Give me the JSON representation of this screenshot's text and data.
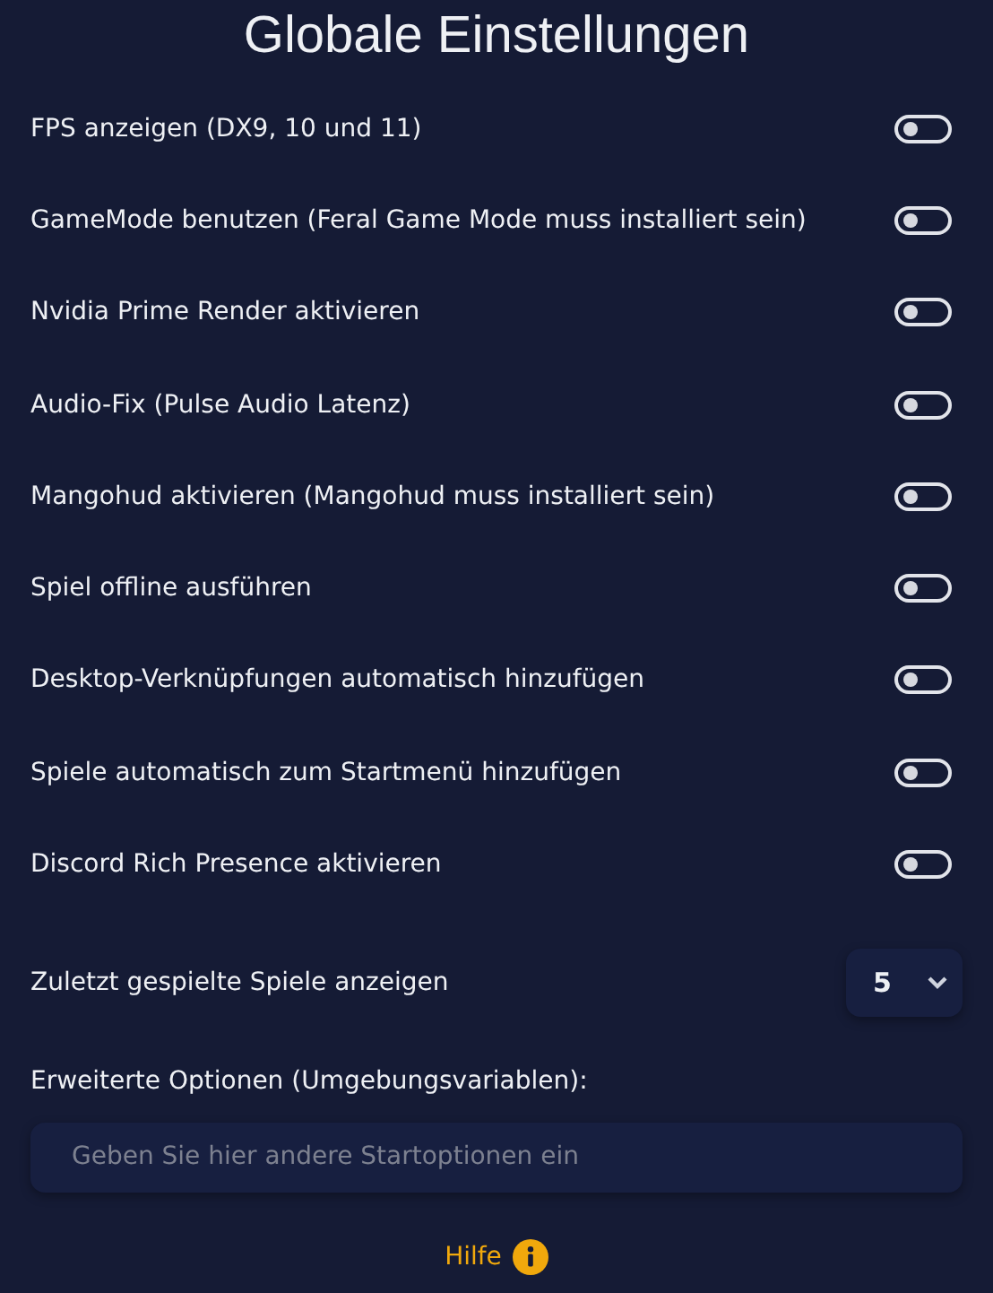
{
  "title": "Globale Einstellungen",
  "settings": [
    {
      "label": "FPS anzeigen (DX9, 10 und 11)",
      "on": false
    },
    {
      "label": "GameMode benutzen (Feral Game Mode muss installiert sein)",
      "on": false
    },
    {
      "label": "Nvidia Prime Render aktivieren",
      "on": false
    },
    {
      "label": "Audio-Fix (Pulse Audio Latenz)",
      "on": false
    },
    {
      "label": "Mangohud aktivieren (Mangohud muss installiert sein)",
      "on": false
    },
    {
      "label": "Spiel offline ausführen",
      "on": false
    },
    {
      "label": "Desktop-Verknüpfungen automatisch hinzufügen",
      "on": false
    },
    {
      "label": "Spiele automatisch zum Startmenü hinzufügen",
      "on": false
    },
    {
      "label": "Discord Rich Presence aktivieren",
      "on": false
    }
  ],
  "recent_games": {
    "label": "Zuletzt gespielte Spiele anzeigen",
    "value": "5"
  },
  "advanced": {
    "label": "Erweiterte Optionen (Umgebungsvariablen):",
    "placeholder": "Geben Sie hier andere Startoptionen ein"
  },
  "help": {
    "label": "Hilfe"
  }
}
